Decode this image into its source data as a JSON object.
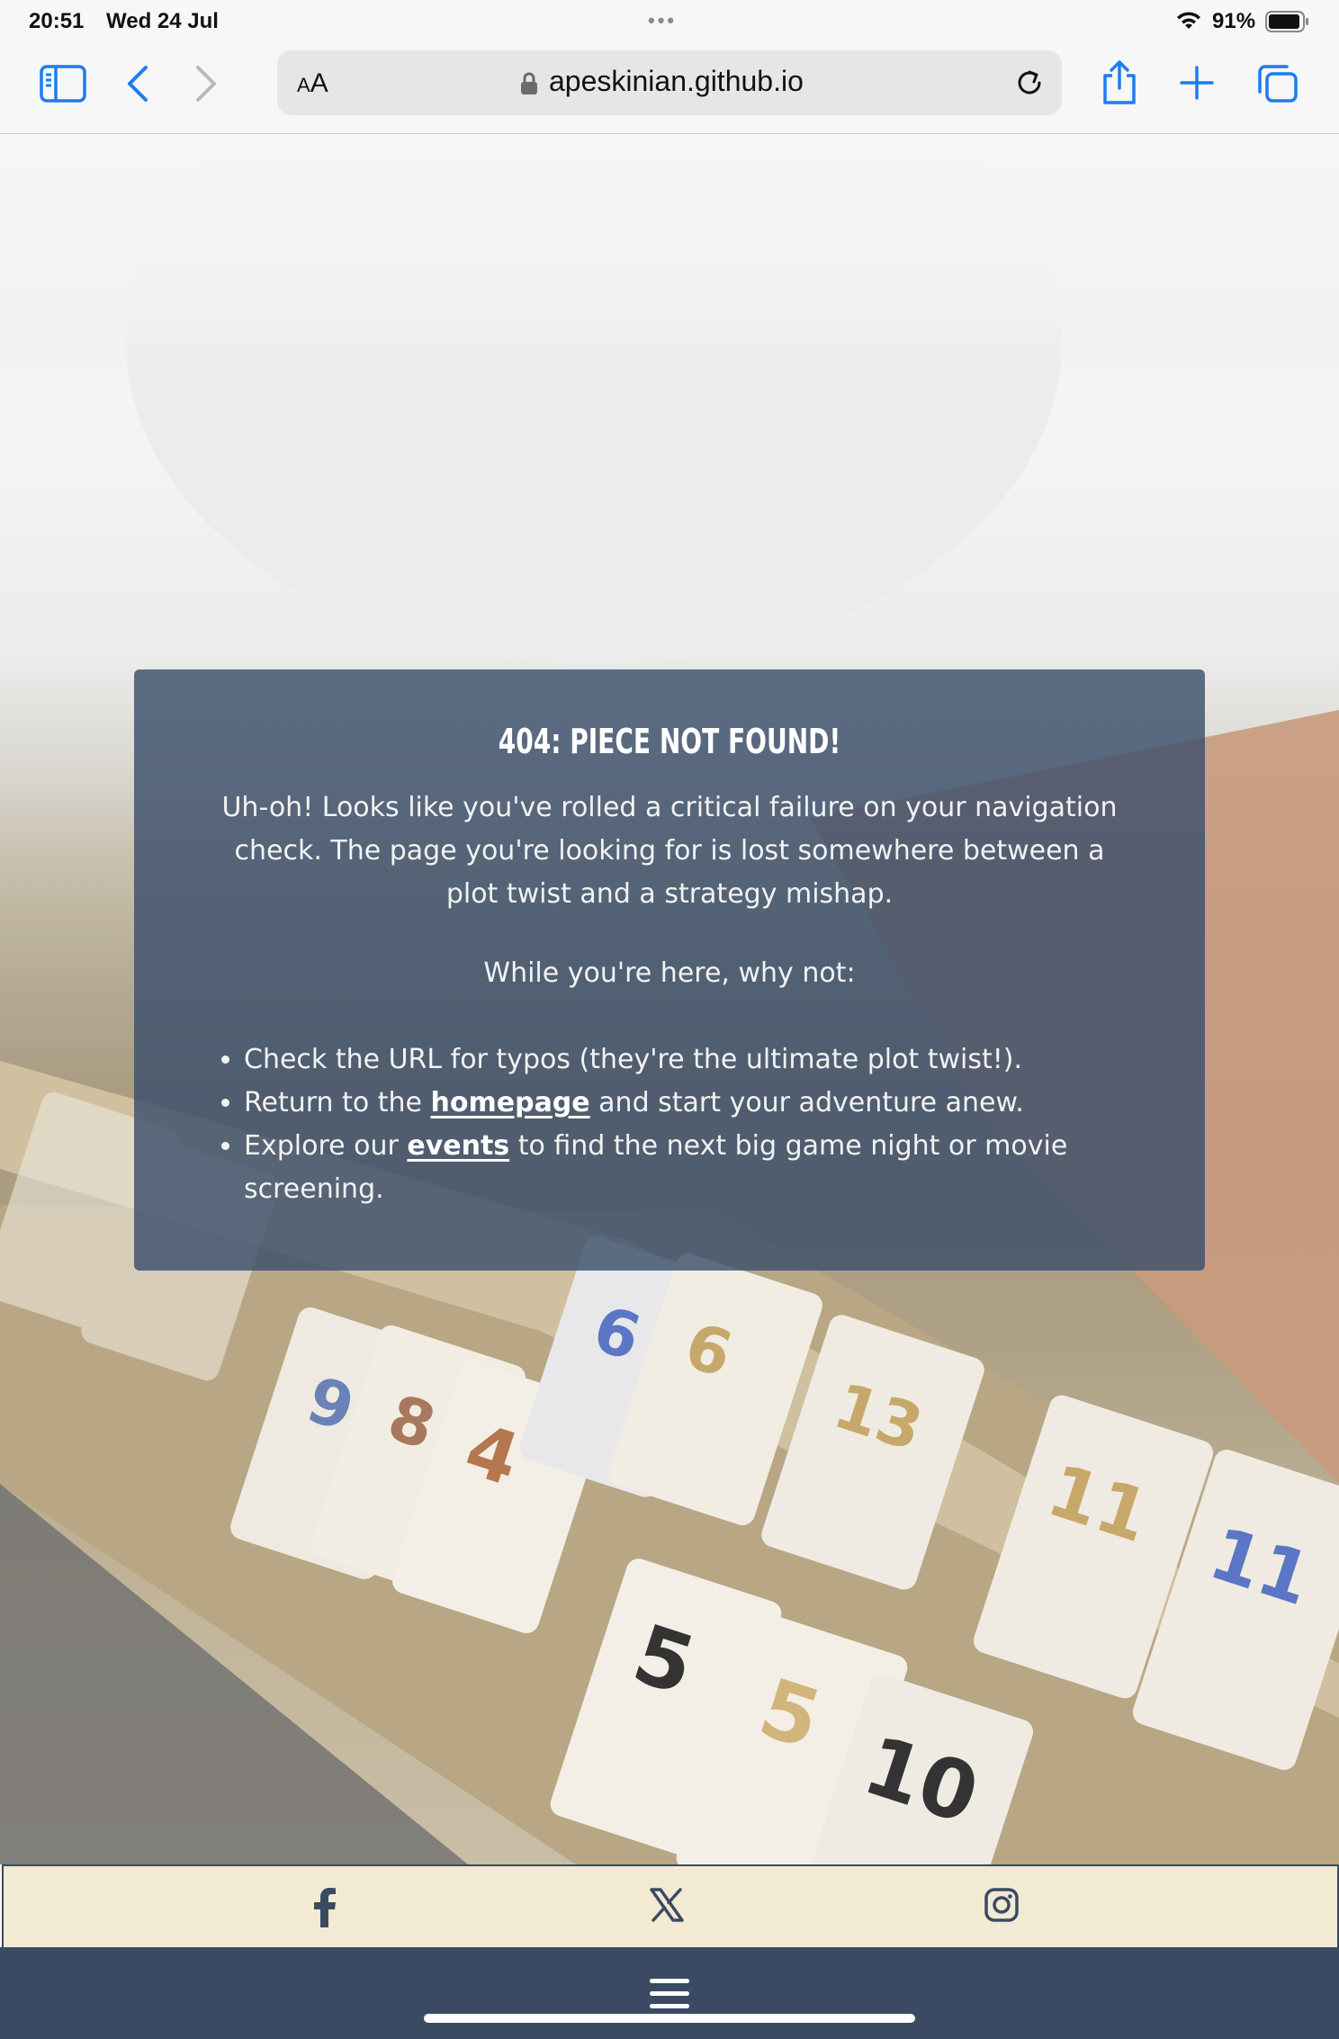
{
  "status_bar": {
    "time": "20:51",
    "date": "Wed 24 Jul",
    "battery": "91%"
  },
  "toolbar": {
    "reader_label": "AA",
    "url": "apeskinian.github.io"
  },
  "card": {
    "title": "404: PIECE NOT FOUND!",
    "intro": "Uh-oh! Looks like you've rolled a critical failure on your navigation check. The page you're looking for is lost somewhere between a plot twist and a strategy mishap.",
    "lead": "While you're here, why not:",
    "item1": "Check the URL for typos (they're the ultimate plot twist!).",
    "item2_before": "Return to the ",
    "item2_link": "homepage",
    "item2_after": " and start your adventure anew.",
    "item3_before": "Explore our ",
    "item3_link": "events",
    "item3_after": " to find the next big game night or movie screening."
  },
  "social": {
    "icons": [
      "facebook-icon",
      "x-icon",
      "instagram-icon"
    ]
  },
  "colors": {
    "card_bg": "#3c4f6b",
    "footer_bg": "#f2ead2",
    "nav_bg": "#3b4a63",
    "safari_blue": "#1e7cf0"
  }
}
